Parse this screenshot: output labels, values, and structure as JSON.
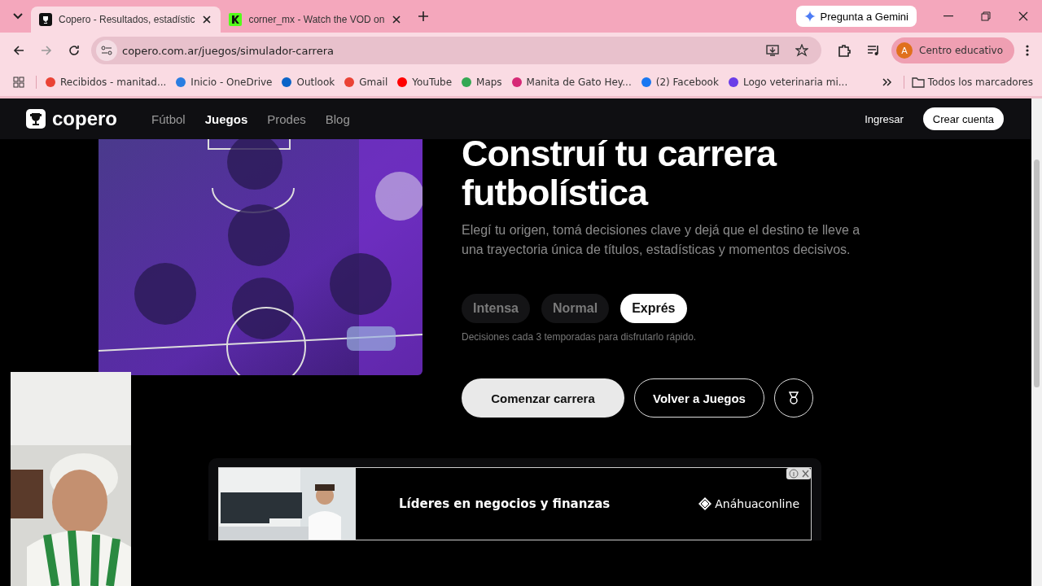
{
  "browser": {
    "tabs": [
      {
        "title": "Copero - Resultados, estadístic",
        "selected": true
      },
      {
        "title": "corner_mx - Watch the VOD on",
        "selected": false
      }
    ],
    "gemini": "Pregunta a Gemini",
    "url": "copero.com.ar/juegos/simulador-carrera",
    "profile_initial": "A",
    "profile": "Centro educativo",
    "bookmarks": [
      "Recibidos - manitad...",
      "Inicio - OneDrive",
      "Outlook",
      "Gmail",
      "YouTube",
      "Maps",
      "Manita de Gato Hey...",
      "(2) Facebook",
      "Logo veterinaria mi..."
    ],
    "all_bookmarks": "Todos los marcadores"
  },
  "site": {
    "logo": "copero",
    "nav": [
      {
        "label": "Fútbol",
        "selected": false
      },
      {
        "label": "Juegos",
        "selected": true
      },
      {
        "label": "Prodes",
        "selected": false
      },
      {
        "label": "Blog",
        "selected": false
      }
    ],
    "login": "Ingresar",
    "signup": "Crear cuenta"
  },
  "hero": {
    "title": "Construí tu carrera futbolística",
    "description": "Elegí tu origen, tomá decisiones clave y dejá que el destino te lleve a una trayectoria única de títulos, estadísticas y momentos decisivos.",
    "modes": [
      {
        "label": "Intensa",
        "selected": false
      },
      {
        "label": "Normal",
        "selected": false
      },
      {
        "label": "Exprés",
        "selected": true
      }
    ],
    "mode_hint": "Decisiones cada 3 temporadas para disfrutarlo rápido.",
    "start": "Comenzar carrera",
    "back": "Volver a Juegos"
  },
  "ad": {
    "headline": "Líderes en negocios y finanzas",
    "brand": "Anáhuaconline"
  }
}
